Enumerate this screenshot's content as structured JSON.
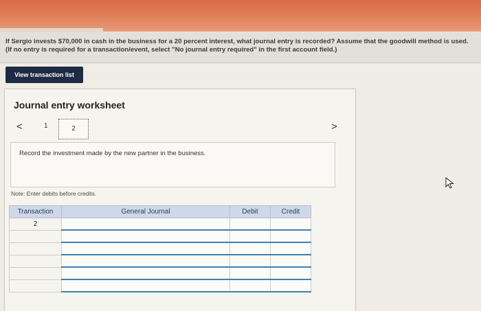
{
  "question": {
    "text": "If Sergio invests $70,000 in cash in the business for a 20 percent interest, what journal entry is recorded? Assume that the goodwill method is used. (If no entry is required for a transaction/event, select \"No journal entry required\" in the first account field.)"
  },
  "buttons": {
    "view_transactions": "View transaction list"
  },
  "worksheet": {
    "title": "Journal entry worksheet",
    "nav": {
      "prev": "<",
      "next": ">",
      "pages": [
        "1",
        "2"
      ],
      "current": "2"
    },
    "instruction": "Record the investment made by the new partner in the business.",
    "note": "Note: Enter debits before credits."
  },
  "table": {
    "headers": [
      "Transaction",
      "General Journal",
      "Debit",
      "Credit"
    ],
    "rows": [
      [
        "2",
        "",
        "",
        ""
      ],
      [
        "",
        "",
        "",
        ""
      ],
      [
        "",
        "",
        "",
        ""
      ],
      [
        "",
        "",
        "",
        ""
      ],
      [
        "",
        "",
        "",
        ""
      ],
      [
        "",
        "",
        "",
        ""
      ]
    ]
  },
  "colors": {
    "banner": "#d86a45",
    "button": "#1f2a44",
    "header_bg": "#cfd8e8",
    "row_rule": "#3f7fb0"
  }
}
